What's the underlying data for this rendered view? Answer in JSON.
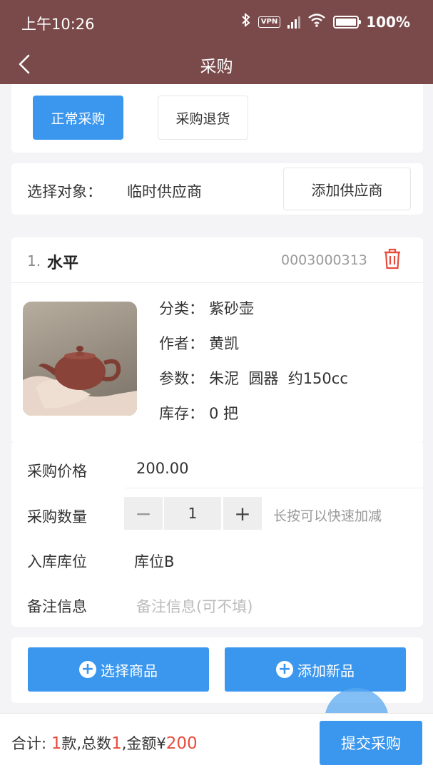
{
  "status": {
    "time": "上午10:26",
    "vpn": "VPN",
    "battery": "100%"
  },
  "nav": {
    "title": "采购"
  },
  "tabs": {
    "normal": "正常采购",
    "return": "采购退货"
  },
  "target": {
    "label": "选择对象：",
    "value": "临时供应商",
    "add_button": "添加供应商"
  },
  "item": {
    "index": "1.",
    "name": "水平",
    "code": "0003000313",
    "category_label": "分类：",
    "category": "紫砂壶",
    "author_label": "作者：",
    "author": "黄凯",
    "params_label": "参数：",
    "params": "朱泥  圆器  约150cc",
    "stock_label": "库存：",
    "stock": "0 把"
  },
  "form": {
    "price_label": "采购价格",
    "price": "200.00",
    "qty_label": "采购数量",
    "qty": "1",
    "qty_hint": "长按可以快速加减",
    "location_label": "入库库位",
    "location": "库位B",
    "note_label": "备注信息",
    "note_placeholder": "备注信息(可不填)"
  },
  "actions": {
    "select_goods": "选择商品",
    "add_new": "添加新品"
  },
  "footer": {
    "total_label": "合计:",
    "kinds": "1",
    "kinds_unit": "款,总数",
    "count": "1",
    "amount_label": ",金额¥",
    "amount": "200",
    "submit": "提交采购"
  },
  "colors": {
    "header": "#7a4a4a",
    "accent": "#3b97ee",
    "danger": "#e74c3c"
  },
  "icons": [
    "back-arrow-icon",
    "bluetooth-icon",
    "wifi-icon",
    "trash-icon",
    "plus-circle-icon"
  ]
}
